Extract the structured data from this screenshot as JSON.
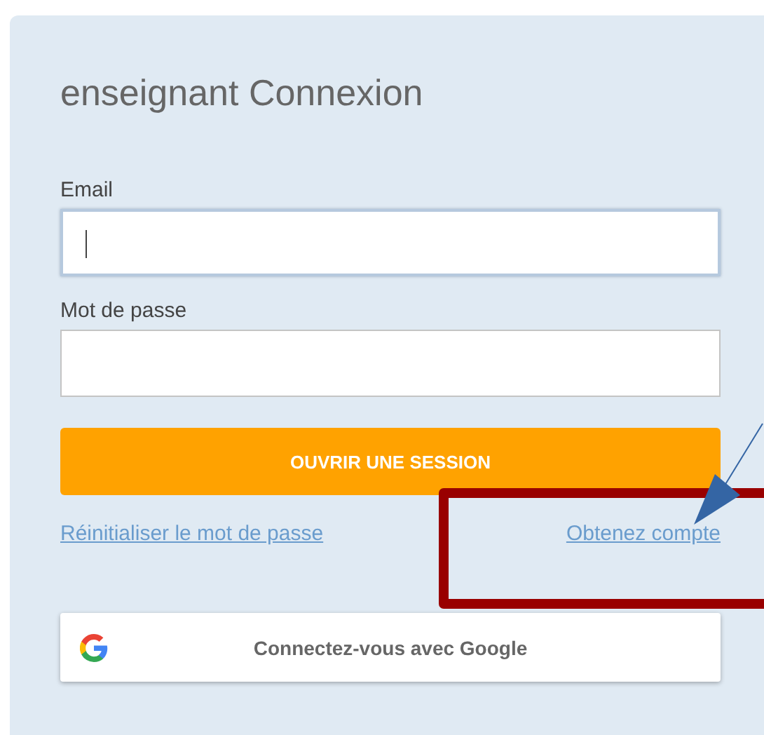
{
  "title": "enseignant Connexion",
  "fields": [
    {
      "label": "Email",
      "focused": true
    },
    {
      "label": "Mot de passe",
      "focused": false
    }
  ],
  "submit_button": "OUVRIR UNE SESSION",
  "links": [
    "Réinitialiser le mot de passe",
    "Obtenez compte"
  ],
  "google_button": "Connectez-vous avec Google"
}
